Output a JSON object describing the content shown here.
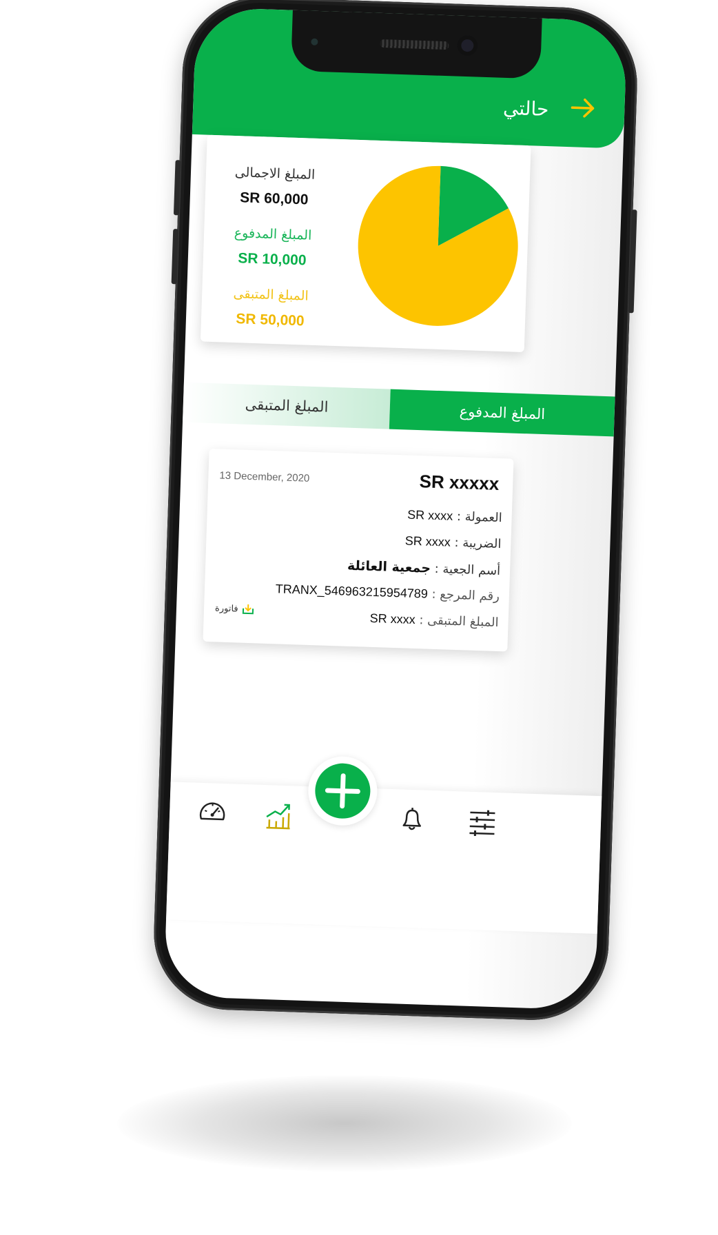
{
  "header": {
    "title": "حالتي",
    "back_icon": "arrow-right-icon"
  },
  "summary": {
    "total_label": "المبلغ الاجمالى",
    "total_value": "SR 60,000",
    "paid_label": "المبلغ المدفوع",
    "paid_value": "SR 10,000",
    "remaining_label": "المبلغ المتبقى",
    "remaining_value": "SR 50,000"
  },
  "chart_data": {
    "type": "pie",
    "slices": [
      {
        "value": 10000,
        "color": "#09b04b"
      },
      {
        "value": 50000,
        "color": "#fdc400"
      }
    ]
  },
  "tabs": {
    "paid_label": "المبلغ المدفوع",
    "remaining_label": "المبلغ المتبقى",
    "active": "paid"
  },
  "transaction": {
    "amount": "SR xxxxx",
    "date": "13 December, 2020",
    "commission_label": "العمولة :",
    "commission_value": "SR xxxx",
    "tax_label": "الضريبة :",
    "tax_value": "SR xxxx",
    "entity_label": "أسم الجعية :",
    "entity_value": "جمعية العائلة",
    "ref_label": "رقم المرجع :",
    "ref_value": "TRANX_546963215954789",
    "remaining_label": "المبلغ المتبقى :",
    "remaining_value": "SR xxxx",
    "invoice_label": "فاتورة",
    "invoice_icon": "download-icon"
  },
  "nav": {
    "items": [
      "speedometer-icon",
      "chart-icon",
      "add-icon",
      "bell-icon",
      "sliders-icon"
    ],
    "active": "chart-icon"
  },
  "colors": {
    "green": "#09b04b",
    "yellow": "#fdc400",
    "paid_text": "#19b559",
    "remaining_text": "#f2c318"
  }
}
